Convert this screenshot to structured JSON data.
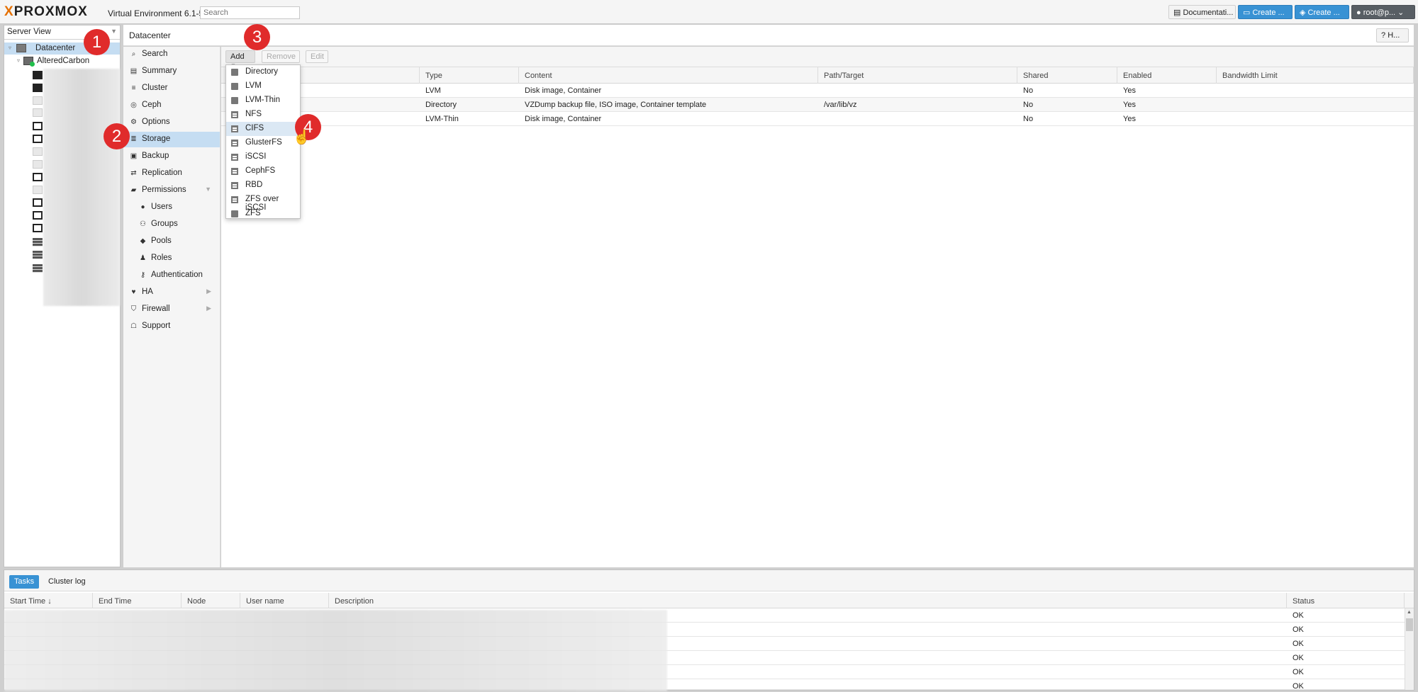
{
  "header": {
    "logo_text": "PROXMOX",
    "version": "Virtual Environment 6.1-5",
    "search_placeholder": "Search",
    "documentation_label": "Documentati...",
    "create_vm_label": "Create ...",
    "create_ct_label": "Create ...",
    "user_label": "root@p..."
  },
  "tree": {
    "view_label": "Server View",
    "datacenter_label": "Datacenter",
    "node_label": "AlteredCarbon"
  },
  "content_header": {
    "breadcrumb": "Datacenter",
    "help_label": "H..."
  },
  "nav": {
    "items": [
      {
        "label": "Search",
        "icon": "search-icon"
      },
      {
        "label": "Summary",
        "icon": "book-icon"
      },
      {
        "label": "Cluster",
        "icon": "server-icon"
      },
      {
        "label": "Ceph",
        "icon": "ceph-icon"
      },
      {
        "label": "Options",
        "icon": "gear-icon"
      },
      {
        "label": "Storage",
        "icon": "database-icon"
      },
      {
        "label": "Backup",
        "icon": "floppy-icon"
      },
      {
        "label": "Replication",
        "icon": "retweet-icon"
      },
      {
        "label": "Permissions",
        "icon": "unlock-icon"
      },
      {
        "label": "Users",
        "icon": "user-icon"
      },
      {
        "label": "Groups",
        "icon": "users-icon"
      },
      {
        "label": "Pools",
        "icon": "tags-icon"
      },
      {
        "label": "Roles",
        "icon": "male-icon"
      },
      {
        "label": "Authentication",
        "icon": "key-icon"
      },
      {
        "label": "HA",
        "icon": "heartbeat-icon"
      },
      {
        "label": "Firewall",
        "icon": "shield-icon"
      },
      {
        "label": "Support",
        "icon": "comments-icon"
      }
    ]
  },
  "toolbar": {
    "add_label": "Add",
    "remove_label": "Remove",
    "edit_label": "Edit"
  },
  "storage_table": {
    "columns": [
      "Type",
      "Content",
      "Path/Target",
      "Shared",
      "Enabled",
      "Bandwidth Limit"
    ],
    "rows": [
      {
        "type": "LVM",
        "content": "Disk image, Container",
        "path": "",
        "shared": "No",
        "enabled": "Yes"
      },
      {
        "type": "Directory",
        "content": "VZDump backup file, ISO image, Container template",
        "path": "/var/lib/vz",
        "shared": "No",
        "enabled": "Yes"
      },
      {
        "type": "LVM-Thin",
        "content": "Disk image, Container",
        "path": "",
        "shared": "No",
        "enabled": "Yes"
      }
    ]
  },
  "add_menu": {
    "items": [
      {
        "label": "Directory",
        "icon": "folder-icon"
      },
      {
        "label": "LVM",
        "icon": "folder-icon"
      },
      {
        "label": "LVM-Thin",
        "icon": "folder-icon"
      },
      {
        "label": "NFS",
        "icon": "building-icon"
      },
      {
        "label": "CIFS",
        "icon": "building-icon"
      },
      {
        "label": "GlusterFS",
        "icon": "building-icon"
      },
      {
        "label": "iSCSI",
        "icon": "building-icon"
      },
      {
        "label": "CephFS",
        "icon": "building-icon"
      },
      {
        "label": "RBD",
        "icon": "building-icon"
      },
      {
        "label": "ZFS over iSCSI",
        "icon": "building-icon"
      },
      {
        "label": "ZFS",
        "icon": "folder-icon"
      }
    ],
    "hovered": "CIFS"
  },
  "log": {
    "tabs": [
      "Tasks",
      "Cluster log"
    ],
    "columns": [
      "Start Time",
      "End Time",
      "Node",
      "User name",
      "Description",
      "Status"
    ],
    "sort_indicator": "↓",
    "statuses": [
      "OK",
      "OK",
      "OK",
      "OK",
      "OK",
      "OK"
    ]
  },
  "annotations": [
    "1",
    "2",
    "3",
    "4"
  ],
  "colors": {
    "accent": "#3892d4",
    "selected": "#c5ddf2",
    "badge": "#e02b2b",
    "logo_x": "#e57000"
  }
}
